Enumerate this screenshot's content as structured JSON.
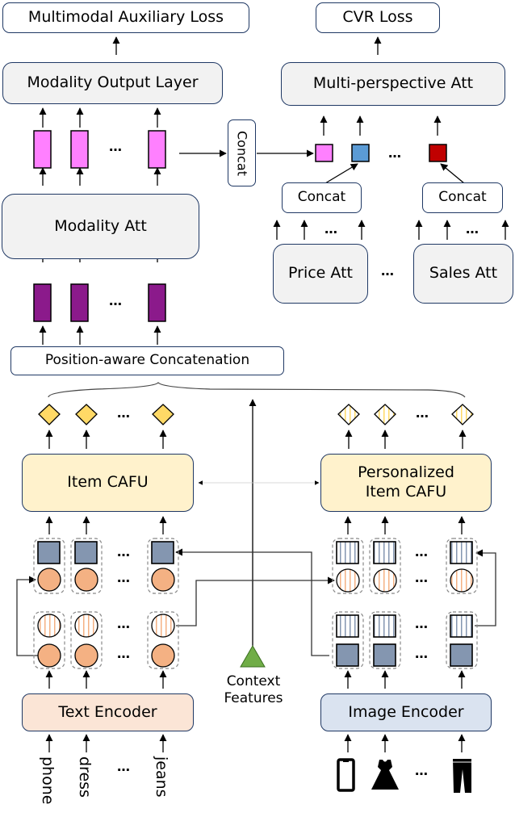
{
  "diagram": {
    "top_left": {
      "loss_label": "Multimodal Auxiliary Loss",
      "output_layer_label": "Modality Output Layer",
      "concat_label": "Concat",
      "modality_att_label": "Modality Att",
      "position_concat_label": "Position-aware Concatenation"
    },
    "top_right": {
      "loss_label": "CVR Loss",
      "multi_att_label": "Multi-perspective Att",
      "concat_left_label": "Concat",
      "concat_right_label": "Concat",
      "price_att_label": "Price Att",
      "sales_att_label": "Sales Att"
    },
    "bottom": {
      "item_cafu_label": "Item CAFU",
      "personalized_cafu_label": "Personalized\nItem CAFU",
      "context_label": "Context\nFeatures",
      "text_encoder_label": "Text Encoder",
      "image_encoder_label": "Image Encoder",
      "text_inputs": [
        "phone",
        "dress",
        "jeans"
      ],
      "image_inputs": [
        "phone-icon",
        "dress-icon",
        "jeans-icon"
      ]
    },
    "ellipsis": "…",
    "colors": {
      "pink_vector": "#ff80ff",
      "purple_vector": "#8b1a8b",
      "blue_square": "#5b9bd5",
      "red_square": "#c00000",
      "yellow_diamond": "#ffd966",
      "orange_circle": "#f4b183",
      "steel_square": "#8496b0",
      "green_triangle": "#70ad47",
      "box_border": "#1f3864"
    }
  }
}
